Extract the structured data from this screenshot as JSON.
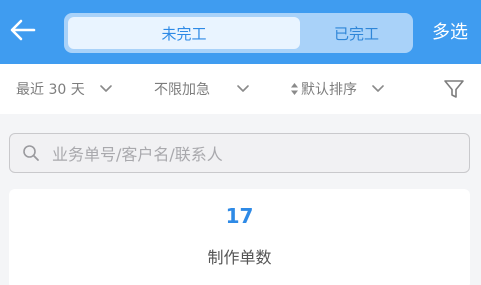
{
  "header": {
    "tabs": [
      {
        "label": "未完工",
        "active": true
      },
      {
        "label": "已完工",
        "active": false
      }
    ],
    "multi_select_label": "多选",
    "back_icon": "arrow-left-icon",
    "color": "#3f9cf0"
  },
  "filters": {
    "date_range": "最近 30 天",
    "urgency": "不限加急",
    "sort": "默认排序",
    "filter_icon": "funnel-icon"
  },
  "search": {
    "placeholder": "业务单号/客户名/联系人"
  },
  "stats": {
    "value": "17",
    "label": "制作单数"
  }
}
